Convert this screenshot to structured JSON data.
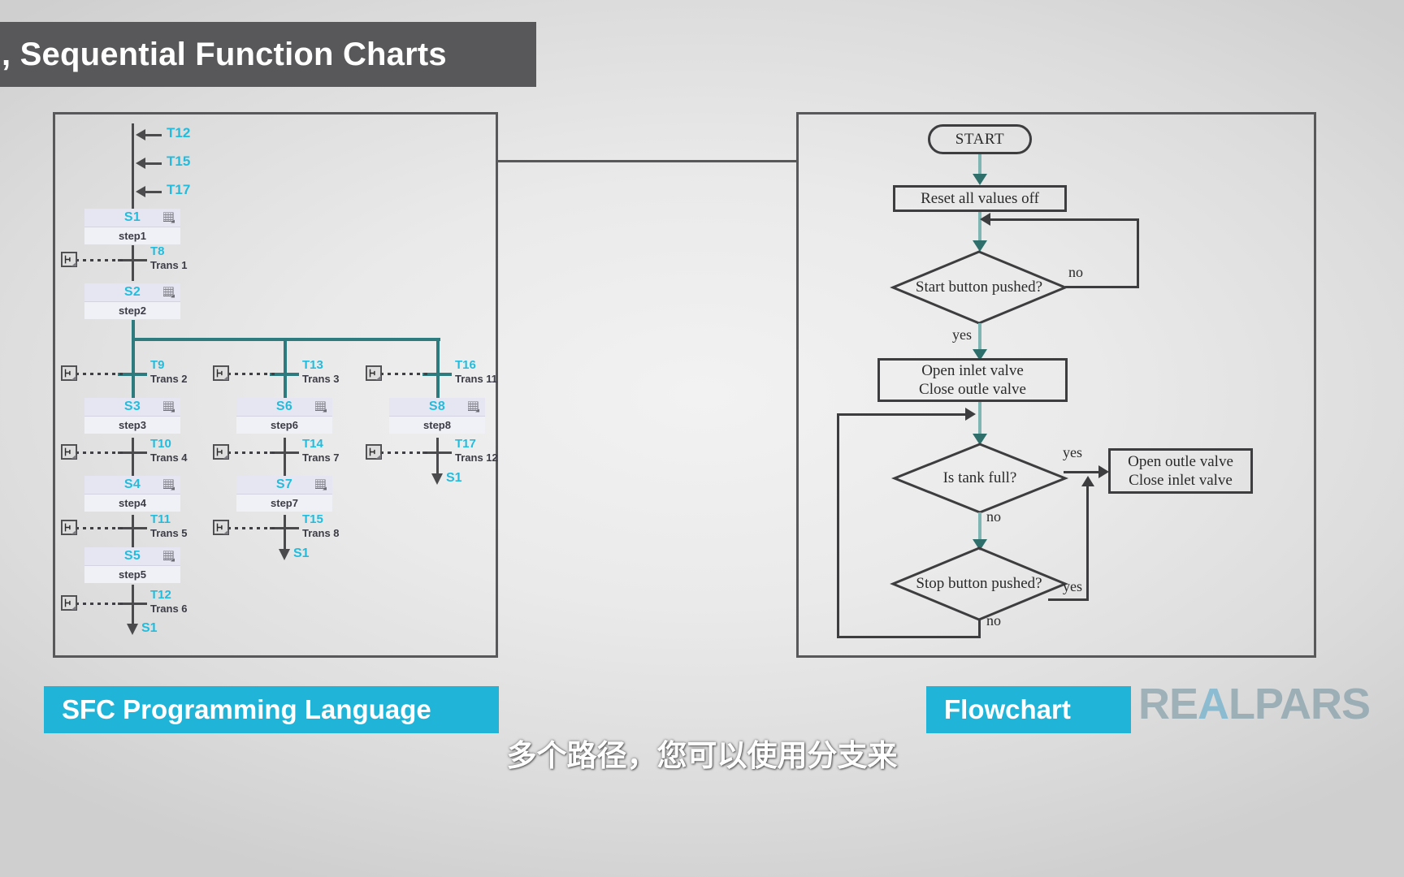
{
  "header": {
    "title": ", Sequential Function Charts"
  },
  "sfc": {
    "banner_label": "SFC Programming Language",
    "incoming_transitions": [
      {
        "label": "T12"
      },
      {
        "label": "T15"
      },
      {
        "label": "T17"
      }
    ],
    "steps": [
      {
        "id": "S1",
        "name": "step1"
      },
      {
        "id": "S2",
        "name": "step2"
      },
      {
        "id": "S3",
        "name": "step3"
      },
      {
        "id": "S4",
        "name": "step4"
      },
      {
        "id": "S5",
        "name": "step5"
      },
      {
        "id": "S6",
        "name": "step6"
      },
      {
        "id": "S7",
        "name": "step7"
      },
      {
        "id": "S8",
        "name": "step8"
      }
    ],
    "transitions": [
      {
        "id": "T8",
        "name": "Trans 1"
      },
      {
        "id": "T9",
        "name": "Trans 2"
      },
      {
        "id": "T10",
        "name": "Trans 4"
      },
      {
        "id": "T11",
        "name": "Trans 5"
      },
      {
        "id": "T12",
        "name": "Trans 6"
      },
      {
        "id": "T13",
        "name": "Trans 3"
      },
      {
        "id": "T14",
        "name": "Trans 7"
      },
      {
        "id": "T15",
        "name": "Trans 8"
      },
      {
        "id": "T16",
        "name": "Trans 11"
      },
      {
        "id": "T17",
        "name": "Trans 12"
      }
    ],
    "jumps": [
      {
        "label": "S1"
      },
      {
        "label": "S1"
      },
      {
        "label": "S1"
      }
    ]
  },
  "flowchart": {
    "banner_label": "Flowchart",
    "nodes": {
      "start": "START",
      "reset": "Reset all values off",
      "start_decision": "Start button pushed?",
      "open_inlet": "Open inlet valve\nClose outle valve",
      "tank_decision": "Is tank full?",
      "open_outlet": "Open outle valve\nClose inlet valve",
      "stop_decision": "Stop button pushed?"
    },
    "edge_labels": {
      "start_no": "no",
      "start_yes": "yes",
      "tank_yes": "yes",
      "tank_no": "no",
      "stop_yes": "yes",
      "stop_no": "no"
    }
  },
  "watermark": {
    "part_a": "RE",
    "part_b": "A",
    "part_c": "LPARS"
  },
  "subtitle": {
    "text": "多个路径，您可以使用分支来"
  },
  "colors": {
    "accent_cyan": "#23bcdd",
    "banner_cyan": "#20b4d8",
    "title_gray": "#58585a",
    "highlight_teal": "#2e7b7f",
    "line_dark": "#4b4b4d"
  }
}
